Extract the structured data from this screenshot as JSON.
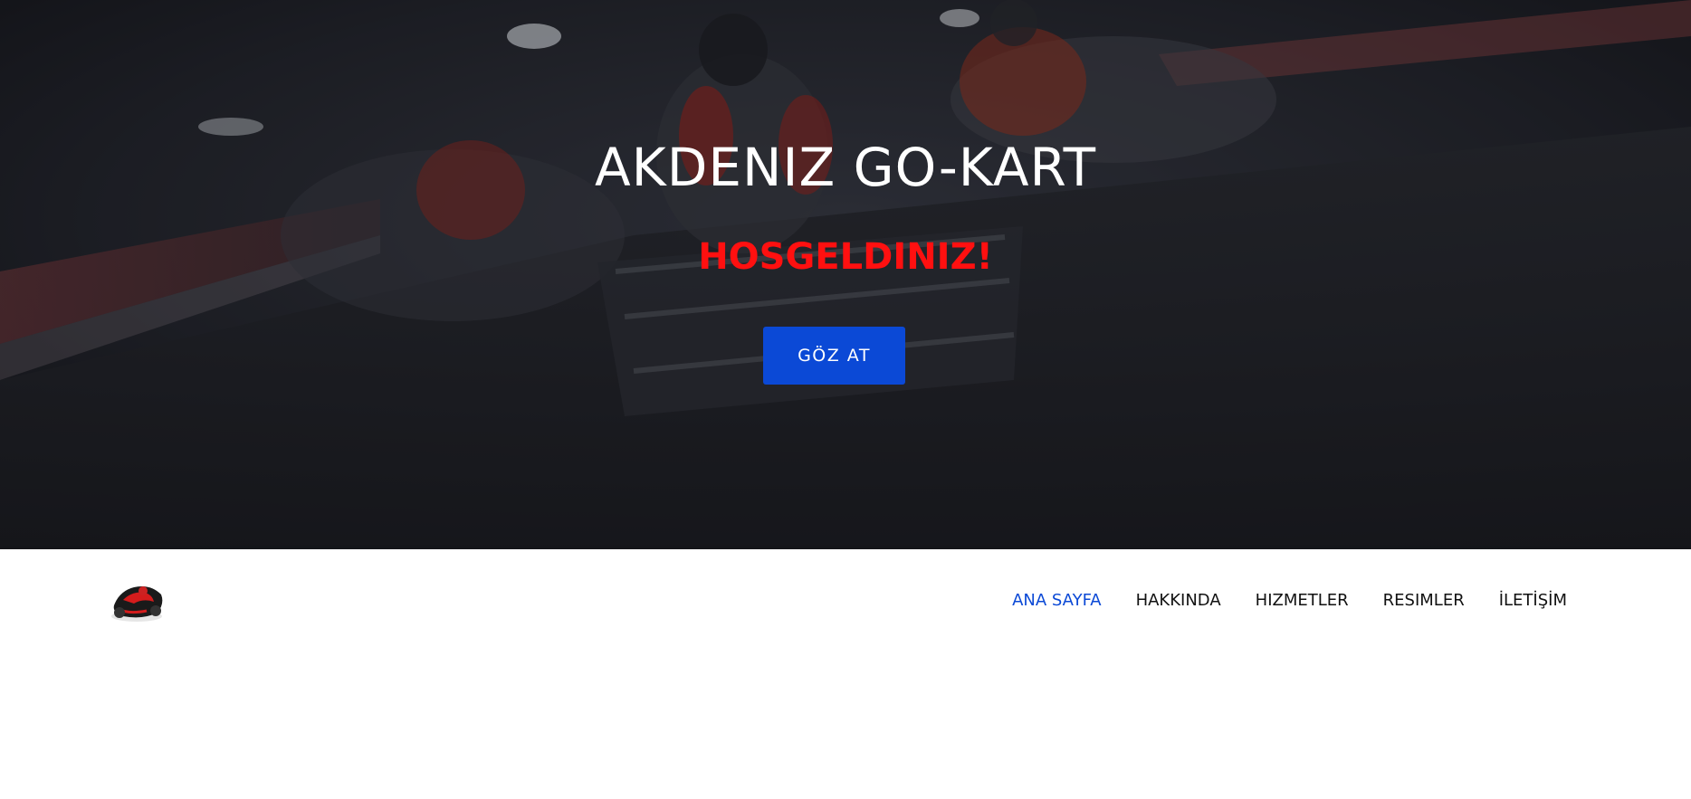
{
  "hero": {
    "title": "AKDENIZ GO-KART",
    "subtitle": "HOSGELDINIZ!",
    "cta_label": "GÖZ AT"
  },
  "nav": {
    "items": [
      {
        "label": "ANA SAYFA",
        "active": true
      },
      {
        "label": "HAKKINDA",
        "active": false
      },
      {
        "label": "HIZMETLER",
        "active": false
      },
      {
        "label": "RESIMLER",
        "active": false
      },
      {
        "label": "İLETİŞİM",
        "active": false
      }
    ]
  },
  "colors": {
    "accent": "#0b49d6",
    "subtitle": "#ff1010",
    "hero_overlay": "#1a1c22"
  },
  "icons": {
    "logo": "go-kart-logo"
  }
}
